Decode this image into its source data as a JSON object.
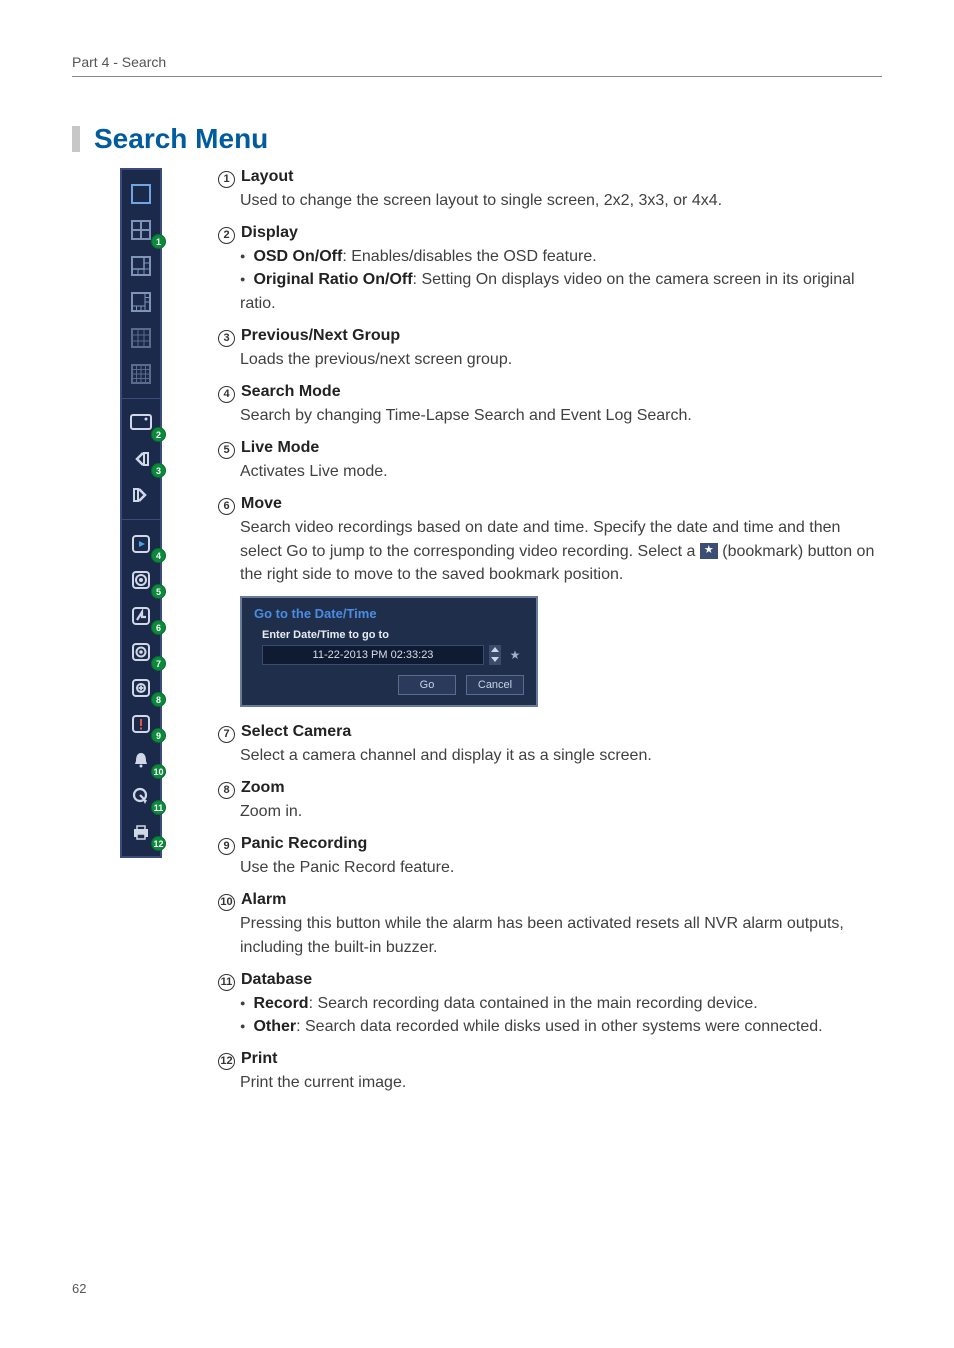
{
  "header": "Part 4 - Search",
  "page_number": "62",
  "title": "Search Menu",
  "sidebar_badges": [
    "1",
    "2",
    "3",
    "4",
    "5",
    "6",
    "7",
    "8",
    "9",
    "10",
    "11",
    "12"
  ],
  "items": [
    {
      "num": "1",
      "title": "Layout",
      "body_plain": "Used to change the screen layout to single screen, 2x2, 3x3, or 4x4."
    },
    {
      "num": "2",
      "title": "Display",
      "bullets": [
        {
          "b": "OSD On/Off",
          "t": ": Enables/disables the OSD feature."
        },
        {
          "b": "Original Ratio On/Off",
          "t": ": Setting On displays video on the camera screen in its original ratio."
        }
      ]
    },
    {
      "num": "3",
      "title": "Previous/Next Group",
      "body_plain": "Loads the previous/next screen group."
    },
    {
      "num": "4",
      "title": "Search Mode",
      "body_plain": "Search by changing Time-Lapse Search and Event Log Search."
    },
    {
      "num": "5",
      "title": "Live Mode",
      "body_plain": "Activates Live mode."
    },
    {
      "num": "6",
      "title": "Move",
      "move_pre": "Search video recordings based on date and time. Specify the date and time and then select Go to jump to the corresponding video recording. Select a ",
      "move_post": " (bookmark) button on the right side to move to the saved bookmark position."
    },
    {
      "num": "7",
      "title": "Select Camera",
      "body_plain": "Select a camera channel and display it as a single screen."
    },
    {
      "num": "8",
      "title": "Zoom",
      "body_plain": "Zoom in."
    },
    {
      "num": "9",
      "title": "Panic Recording",
      "body_plain": "Use the Panic Record feature."
    },
    {
      "num": "10",
      "title": "Alarm",
      "body_plain": "Pressing this button while the alarm has been activated resets all NVR alarm outputs, including the built-in buzzer."
    },
    {
      "num": "11",
      "title": "Database",
      "bullets": [
        {
          "b": "Record",
          "t": ": Search recording data contained in the main recording device."
        },
        {
          "b": "Other",
          "t": ": Search data recorded while disks used in other systems were connected."
        }
      ]
    },
    {
      "num": "12",
      "title": "Print",
      "body_plain": "Print the current image."
    }
  ],
  "dialog": {
    "title": "Go to the Date/Time",
    "label": "Enter Date/Time to go to",
    "value": "11-22-2013  PM 02:33:23",
    "go": "Go",
    "cancel": "Cancel"
  }
}
